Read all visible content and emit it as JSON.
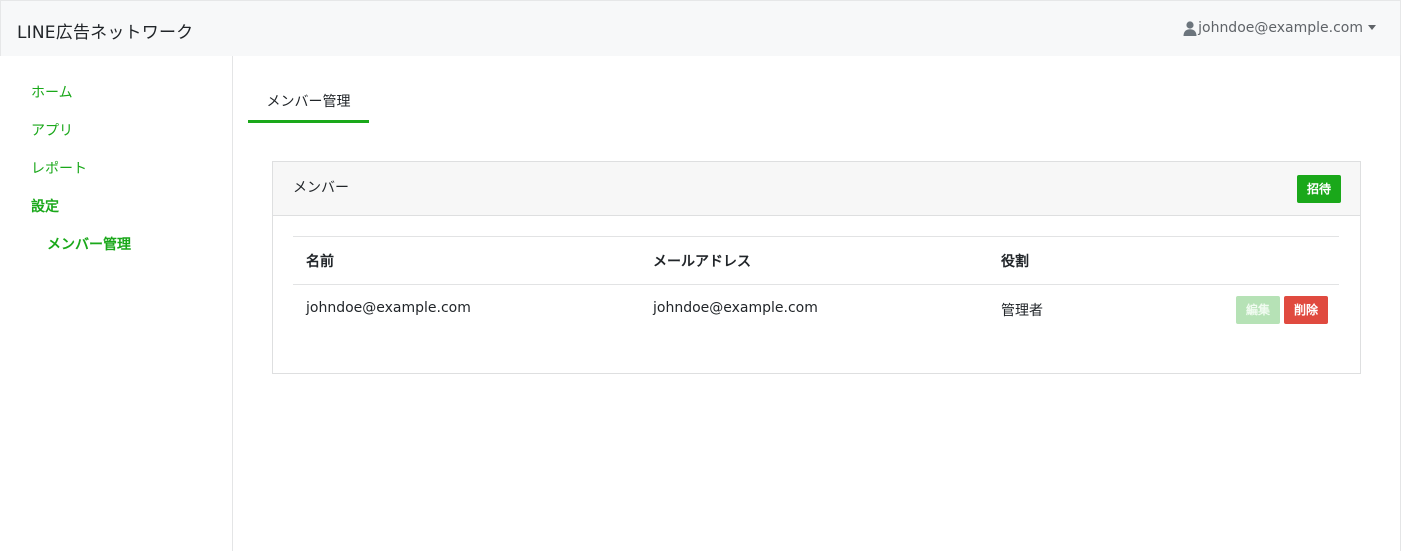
{
  "app": {
    "title": "LINE広告ネットワーク"
  },
  "user": {
    "email": "johndoe@example.com",
    "icon": "user-icon"
  },
  "sidebar": {
    "items": [
      {
        "label": "ホーム"
      },
      {
        "label": "アプリ"
      },
      {
        "label": "レポート"
      },
      {
        "label": "設定"
      },
      {
        "label": "メンバー管理"
      }
    ]
  },
  "tabs": [
    {
      "label": "メンバー管理",
      "active": true
    }
  ],
  "card": {
    "title": "メンバー",
    "invite_label": "招待",
    "table": {
      "headers": [
        "名前",
        "メールアドレス",
        "役割"
      ],
      "rows": [
        {
          "name": "johndoe@example.com",
          "email": "johndoe@example.com",
          "role": "管理者",
          "edit_label": "編集",
          "delete_label": "削除"
        }
      ]
    }
  },
  "colors": {
    "accent": "#1aa81a",
    "danger": "#e04a3f",
    "disabled": "#b6e2b6"
  }
}
